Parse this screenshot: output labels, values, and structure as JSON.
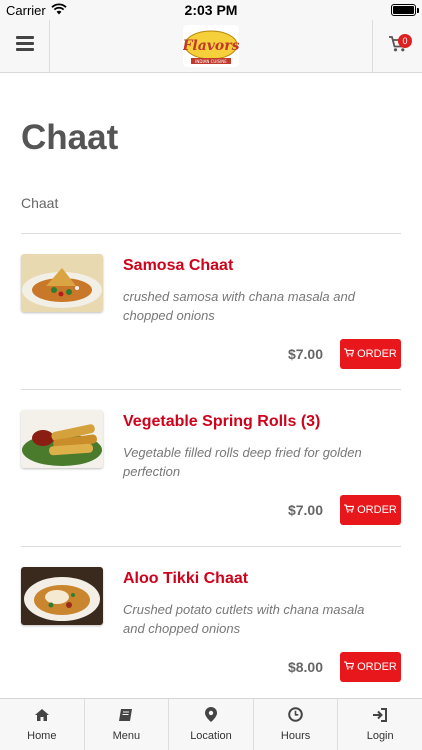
{
  "status_bar": {
    "carrier": "Carrier",
    "time": "2:03 PM"
  },
  "header": {
    "logo_text": "Flavors",
    "logo_subtext": "INDIAN CUISINE",
    "cart_count": "0"
  },
  "page": {
    "title": "Chaat",
    "section_label": "Chaat"
  },
  "colors": {
    "accent": "#e8171b",
    "item_name": "#d0021b"
  },
  "items": [
    {
      "name": "Samosa Chaat",
      "description": "crushed samosa with chana masala and chopped onions",
      "price": "$7.00",
      "order_label": "ORDER"
    },
    {
      "name": "Vegetable Spring Rolls (3)",
      "description": "Vegetable filled rolls deep fried for golden perfection",
      "price": "$7.00",
      "order_label": "ORDER"
    },
    {
      "name": "Aloo Tikki Chaat",
      "description": "Crushed potato cutlets with chana masala and chopped onions",
      "price": "$8.00",
      "order_label": "ORDER"
    }
  ],
  "tabs": [
    {
      "label": "Home",
      "icon": "home-icon"
    },
    {
      "label": "Menu",
      "icon": "book-icon"
    },
    {
      "label": "Location",
      "icon": "map-pin-icon"
    },
    {
      "label": "Hours",
      "icon": "clock-icon"
    },
    {
      "label": "Login",
      "icon": "login-icon"
    }
  ]
}
